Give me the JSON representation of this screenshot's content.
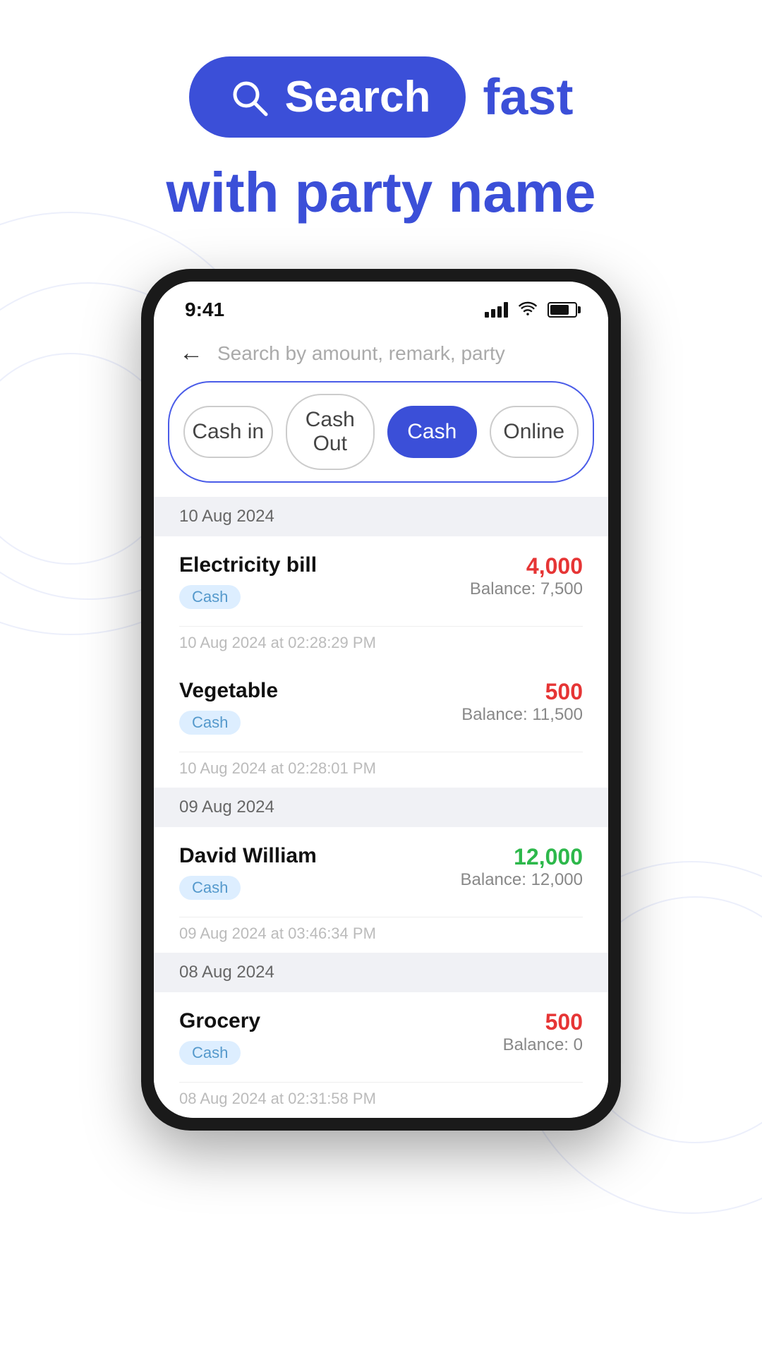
{
  "hero": {
    "search_pill_label": "Search",
    "fast_label": "fast",
    "subtitle": "with party name"
  },
  "phone": {
    "status_bar": {
      "time": "9:41"
    },
    "search_placeholder": "Search by amount, remark, party",
    "filter_tabs": [
      {
        "id": "cash-in",
        "label": "Cash in",
        "active": false
      },
      {
        "id": "cash-out",
        "label": "Cash Out",
        "active": false
      },
      {
        "id": "cash",
        "label": "Cash",
        "active": true
      },
      {
        "id": "online",
        "label": "Online",
        "active": false
      }
    ],
    "transactions": [
      {
        "date": "10 Aug 2024",
        "items": [
          {
            "name": "Electricity bill",
            "amount": "4,000",
            "amount_type": "red",
            "tag": "Cash",
            "balance": "Balance: 7,500",
            "timestamp": "10 Aug 2024 at 02:28:29 PM"
          },
          {
            "name": "Vegetable",
            "amount": "500",
            "amount_type": "red",
            "tag": "Cash",
            "balance": "Balance: 11,500",
            "timestamp": "10 Aug 2024 at 02:28:01 PM"
          }
        ]
      },
      {
        "date": "09 Aug 2024",
        "items": [
          {
            "name": "David William",
            "amount": "12,000",
            "amount_type": "green",
            "tag": "Cash",
            "balance": "Balance: 12,000",
            "timestamp": "09 Aug 2024 at 03:46:34 PM"
          }
        ]
      },
      {
        "date": "08 Aug 2024",
        "items": [
          {
            "name": "Grocery",
            "amount": "500",
            "amount_type": "red",
            "tag": "Cash",
            "balance": "Balance: 0",
            "timestamp": "08 Aug 2024 at 02:31:58 PM"
          }
        ]
      }
    ]
  }
}
